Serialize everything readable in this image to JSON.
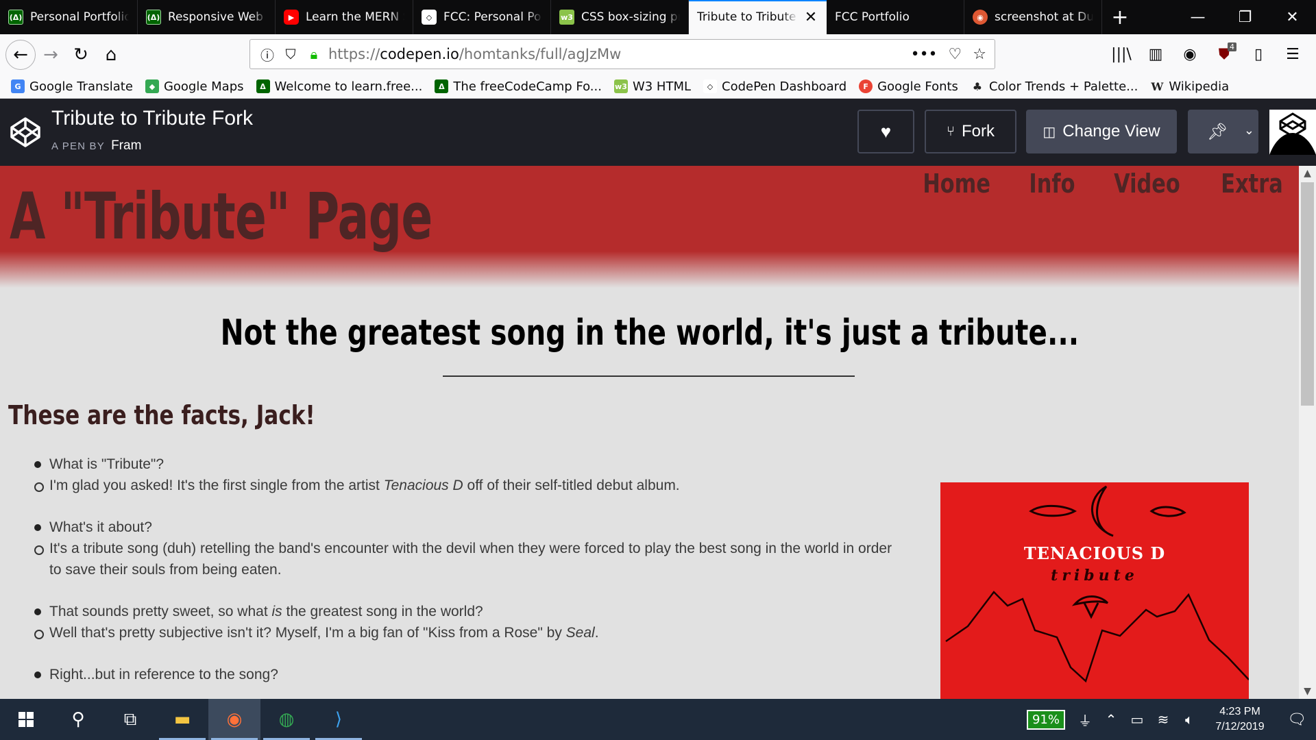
{
  "browser": {
    "tabs": [
      {
        "title": "Personal Portfolio",
        "icon": "fcc-icon"
      },
      {
        "title": "Responsive Web Design",
        "icon": "fcc-icon"
      },
      {
        "title": "Learn the MERN Stack",
        "icon": "youtube-icon"
      },
      {
        "title": "FCC: Personal Portfolio",
        "icon": "codepen-icon"
      },
      {
        "title": "CSS box-sizing property",
        "icon": "w3-icon"
      },
      {
        "title": "Tribute to Tribute Fork",
        "icon": "none",
        "active": true
      },
      {
        "title": "FCC Portfolio",
        "icon": "none"
      },
      {
        "title": "screenshot at DuckDuckGo",
        "icon": "duckduckgo-icon"
      }
    ],
    "url_scheme": "https://",
    "url_host": "codepen.io",
    "url_path": "/homtanks/full/agJzMw",
    "ublock_count": "4",
    "bookmarks": [
      {
        "label": "Google Translate",
        "icon": "google-translate-icon"
      },
      {
        "label": "Google Maps",
        "icon": "google-maps-icon"
      },
      {
        "label": "Welcome to learn.free...",
        "icon": "fcc-icon"
      },
      {
        "label": "The freeCodeCamp Fo...",
        "icon": "fcc-icon"
      },
      {
        "label": "W3 HTML",
        "icon": "w3-icon"
      },
      {
        "label": "CodePen Dashboard",
        "icon": "codepen-icon"
      },
      {
        "label": "Google Fonts",
        "icon": "google-fonts-icon"
      },
      {
        "label": "Color Trends + Palette...",
        "icon": "palette-icon"
      },
      {
        "label": "Wikipedia",
        "icon": "wikipedia-icon"
      }
    ]
  },
  "codepen": {
    "title": "Tribute to Tribute Fork",
    "byline": "A PEN BY",
    "author": "Fram",
    "fork_label": "Fork",
    "change_view_label": "Change View"
  },
  "page": {
    "hero_title": "A \"Tribute\" Page",
    "nav": [
      "Home",
      "Info",
      "Video",
      "Extra"
    ],
    "tagline": "Not the greatest song in the world, it's just a tribute...",
    "facts_heading": "These are the facts, Jack!",
    "faq": [
      {
        "q": "What is \"Tribute\"?",
        "a_pre": "I'm glad you asked! It's the first single from the artist ",
        "a_em": "Tenacious D",
        "a_post": " off of their self-titled debut album."
      },
      {
        "q": "What's it about?",
        "a_pre": "It's a tribute song (duh) retelling the band's encounter with the devil when they were forced to play the best song in the world in order to save their souls from being eaten.",
        "a_em": "",
        "a_post": ""
      },
      {
        "q_pre": "That sounds pretty sweet, so what ",
        "q_em": "is",
        "q_post": " the greatest song in the world?",
        "a_pre": "Well that's pretty subjective isn't it? Myself, I'm a big fan of \"Kiss from a Rose\" by ",
        "a_em": "Seal",
        "a_post": "."
      },
      {
        "q": "Right...but in reference to the song?"
      }
    ],
    "album_band": "TENACIOUS D",
    "album_sub": "tribute"
  },
  "taskbar": {
    "battery": "91%",
    "time": "4:23 PM",
    "date": "7/12/2019"
  },
  "colors": {
    "hero_red": "#b52c2c",
    "hero_text": "#4e2525",
    "page_bg": "#e1e1e1",
    "album_red": "#e31b1b",
    "codepen_header": "#1e1f26"
  }
}
